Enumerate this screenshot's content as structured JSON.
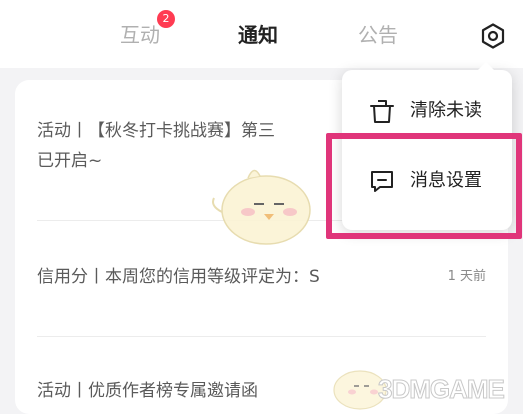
{
  "tabs": [
    {
      "label": "互动",
      "badge": "2"
    },
    {
      "label": "通知",
      "active": true
    },
    {
      "label": "公告"
    }
  ],
  "header": {
    "settings_icon": "gear-icon"
  },
  "notifications": [
    {
      "line1": "活动丨【秋冬打卡挑战赛】第三",
      "line2": "已开启~"
    },
    {
      "text": "信用分丨本周您的信用等级评定为：S",
      "time": "1 天前"
    },
    {
      "text": "活动丨优质作者榜专属邀请函"
    }
  ],
  "menu": {
    "items": [
      {
        "label": "清除未读",
        "icon": "trash-icon"
      },
      {
        "label": "消息设置",
        "icon": "message-settings-icon"
      }
    ]
  },
  "watermark": {
    "text": "3DMGAME"
  },
  "colors": {
    "badge": "#ff3b52",
    "highlight": "#e0357a",
    "active_tab": "#222222",
    "inactive_tab": "#b0b0b0"
  }
}
